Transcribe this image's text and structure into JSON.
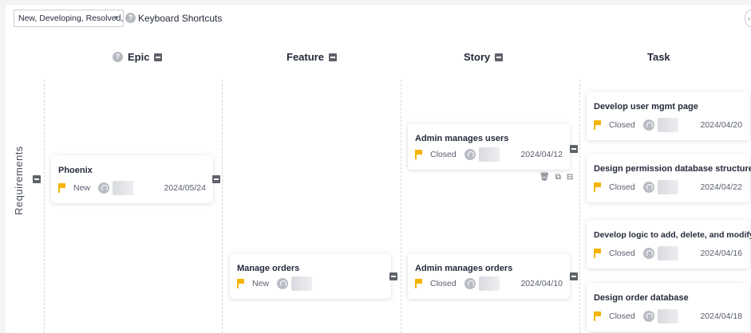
{
  "toolbar": {
    "filter_value": "New, Developing, Resolved, T...",
    "filter_caret": "▼",
    "help_glyph": "?",
    "keyboard_shortcuts": "Keyboard Shortcuts",
    "corner_glyph": "‹"
  },
  "columns": [
    {
      "label": "Epic",
      "has_help": true
    },
    {
      "label": "Feature",
      "has_help": false
    },
    {
      "label": "Story",
      "has_help": false
    },
    {
      "label": "Task",
      "has_help": false
    }
  ],
  "row_label": "Requirements",
  "cards": {
    "epic_phoenix": {
      "title": "Phoenix",
      "status": "New",
      "date": "2024/05/24"
    },
    "feature_manage_orders": {
      "title": "Manage orders",
      "status": "New",
      "date": ""
    },
    "story_admin_users": {
      "title": "Admin manages users",
      "status": "Closed",
      "date": "2024/04/12"
    },
    "story_admin_orders": {
      "title": "Admin manages orders",
      "status": "Closed",
      "date": "2024/04/10"
    },
    "task_user_mgmt": {
      "title": "Develop user mgmt page",
      "status": "Closed",
      "date": "2024/04/20"
    },
    "task_permission_db": {
      "title": "Design permission database structure",
      "status": "Closed",
      "date": "2024/04/22"
    },
    "task_order_logic": {
      "title": "Develop logic to add, delete, and modify orders",
      "status": "Closed",
      "date": "2024/04/16"
    },
    "task_order_db": {
      "title": "Design order database",
      "status": "Closed",
      "date": "2024/04/18"
    }
  },
  "card_actions": {
    "delete_icon": "🗑",
    "copy_icon": "⧉",
    "split_icon": "⊟"
  },
  "colors": {
    "flag": "#f5b400",
    "collapse": "#5e6168",
    "background": "#f3f4f6"
  }
}
